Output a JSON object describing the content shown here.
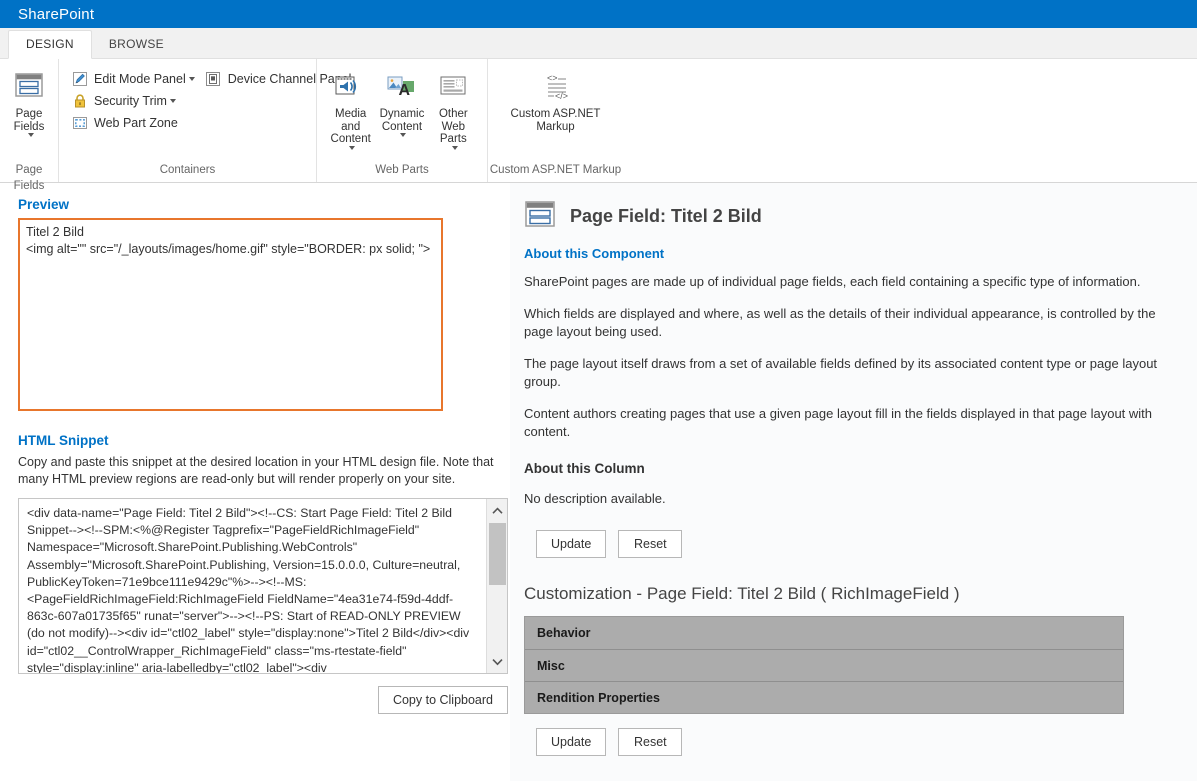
{
  "suite": {
    "title": "SharePoint"
  },
  "tabs": [
    {
      "label": "DESIGN",
      "active": true
    },
    {
      "label": "BROWSE",
      "active": false
    }
  ],
  "ribbon": {
    "groups": [
      {
        "name": "page-fields",
        "label": "Page Fields",
        "big_buttons": [
          {
            "label": "Page\nFields",
            "icon": "page-fields-icon",
            "has_caret": true
          }
        ]
      },
      {
        "name": "containers",
        "label": "Containers",
        "small_buttons": [
          {
            "label": "Edit Mode Panel",
            "icon": "edit-mode-panel-icon",
            "has_caret": true
          },
          {
            "label": "Security Trim",
            "icon": "security-trim-icon",
            "has_caret": true
          },
          {
            "label": "Web Part Zone",
            "icon": "web-part-zone-icon",
            "has_caret": false
          },
          {
            "label": "Device Channel Panel",
            "icon": "device-channel-panel-icon",
            "has_caret": false
          }
        ]
      },
      {
        "name": "web-parts",
        "label": "Web Parts",
        "big_buttons": [
          {
            "label": "Media and\nContent",
            "icon": "media-and-content-icon",
            "has_caret": true
          },
          {
            "label": "Dynamic\nContent",
            "icon": "dynamic-content-icon",
            "has_caret": true
          },
          {
            "label": "Other Web\nParts",
            "icon": "other-web-parts-icon",
            "has_caret": true
          }
        ]
      },
      {
        "name": "custom-aspnet-markup",
        "label": "Custom ASP.NET Markup",
        "big_buttons": [
          {
            "label": "Custom ASP.NET\nMarkup",
            "icon": "custom-aspnet-markup-icon",
            "has_caret": false
          }
        ]
      }
    ]
  },
  "left": {
    "preview": {
      "title": "Preview",
      "line1": "Titel 2 Bild",
      "line2": "<img alt=\"\" src=\"/_layouts/images/home.gif\" style=\"BORDER: px solid; \">"
    },
    "snippet": {
      "title": "HTML Snippet",
      "description": "Copy and paste this snippet at the desired location in your HTML design file. Note that many HTML preview regions are read-only but will render properly on your site.",
      "code": "<div data-name=\"Page Field: Titel 2 Bild\"><!--CS: Start Page Field: Titel 2 Bild Snippet--><!--SPM:<%@Register Tagprefix=\"PageFieldRichImageField\" Namespace=\"Microsoft.SharePoint.Publishing.WebControls\" Assembly=\"Microsoft.SharePoint.Publishing, Version=15.0.0.0, Culture=neutral, PublicKeyToken=71e9bce111e9429c\"%>--><!--MS:<PageFieldRichImageField:RichImageField FieldName=\"4ea31e74-f59d-4ddf-863c-607a01735f65\" runat=\"server\">--><!--PS: Start of READ-ONLY PREVIEW (do not modify)--><div id=\"ctl02_label\" style=\"display:none\">Titel 2 Bild</div><div id=\"ctl02__ControlWrapper_RichImageField\" class=\"ms-rtestate-field\" style=\"display:inline\" aria-labelledby=\"ctl02_label\"><div",
      "copy_button": "Copy to Clipboard"
    }
  },
  "right": {
    "title": "Page Field: Titel 2 Bild",
    "about_component_heading": "About this Component",
    "paragraphs": [
      "SharePoint pages are made up of individual page fields, each field containing a specific type of information.",
      "Which fields are displayed and where, as well as the details of their individual appearance, is controlled by the page layout being used.",
      "The page layout itself draws from a set of available fields defined by its associated content type or page layout group.",
      "Content authors creating pages that use a given page layout fill in the fields displayed in that page layout with content."
    ],
    "about_column_heading": "About this Column",
    "about_column_text": "No description available.",
    "buttons": {
      "update": "Update",
      "reset": "Reset"
    },
    "customization": {
      "title": "Customization - Page Field: Titel 2 Bild ( RichImageField )",
      "sections": [
        {
          "label": "Behavior"
        },
        {
          "label": "Misc"
        },
        {
          "label": "Rendition Properties"
        }
      ],
      "buttons": {
        "update": "Update",
        "reset": "Reset"
      }
    }
  },
  "colors": {
    "suite_blue": "#0072c6",
    "link_blue": "#0072c6",
    "preview_border_orange": "#e8762c",
    "accordion_gray": "#acacac"
  }
}
